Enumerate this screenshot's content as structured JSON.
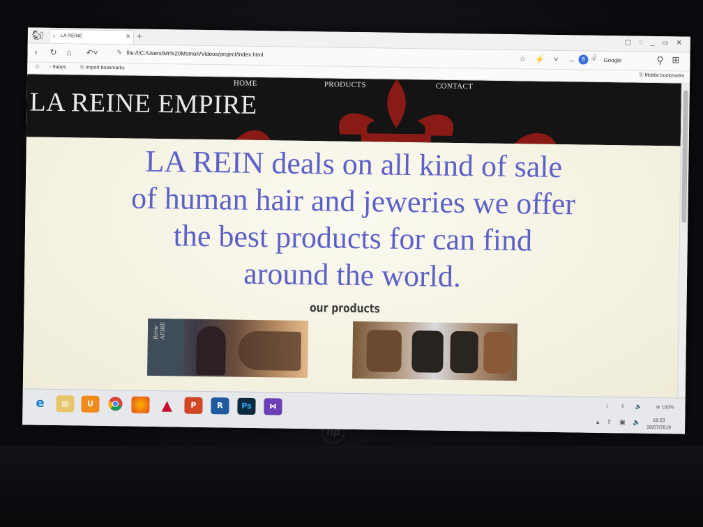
{
  "browser": {
    "tab_title": "LA REINE",
    "tab_close": "×",
    "new_tab": "+",
    "window_controls": "▢ ◌ _ ▭ ✕",
    "url": "file:///C:/Users/Mr%20Momoh/Videos/project/index.html",
    "search_engine_name": "Google",
    "search_engine_letter": "8",
    "nav_icons": [
      "arrow-left-icon",
      "reload-icon",
      "home-icon",
      "undo-icon"
    ],
    "bookmarks": [
      "9apps",
      "Import bookmarks"
    ],
    "mobile_bookmarks": "Mobile bookmarks"
  },
  "site": {
    "nav": [
      "HOME",
      "PRODUCTS",
      "CONTACT"
    ],
    "title": "LA REINE EMPIRE",
    "hero_text": "LA REIN deals on all kind of sale of human hair and jeweries we offer the best products for can find around the world.",
    "products_heading": "our products",
    "product_cover_text": "Reine APIRE"
  },
  "taskbar": {
    "apps": [
      "ie-icon",
      "file-explorer-icon",
      "uc-browser-icon",
      "chrome-icon",
      "firefox-icon",
      "autocad-icon",
      "powerpoint-icon",
      "revit-icon",
      "photoshop-icon",
      "visual-studio-icon"
    ],
    "zoom": "100%",
    "time": "18:23",
    "date": "18/07/2019"
  },
  "colors": {
    "hero_text": "#5d61c7",
    "header_bg": "#141414",
    "motif": "#8a1a16"
  }
}
